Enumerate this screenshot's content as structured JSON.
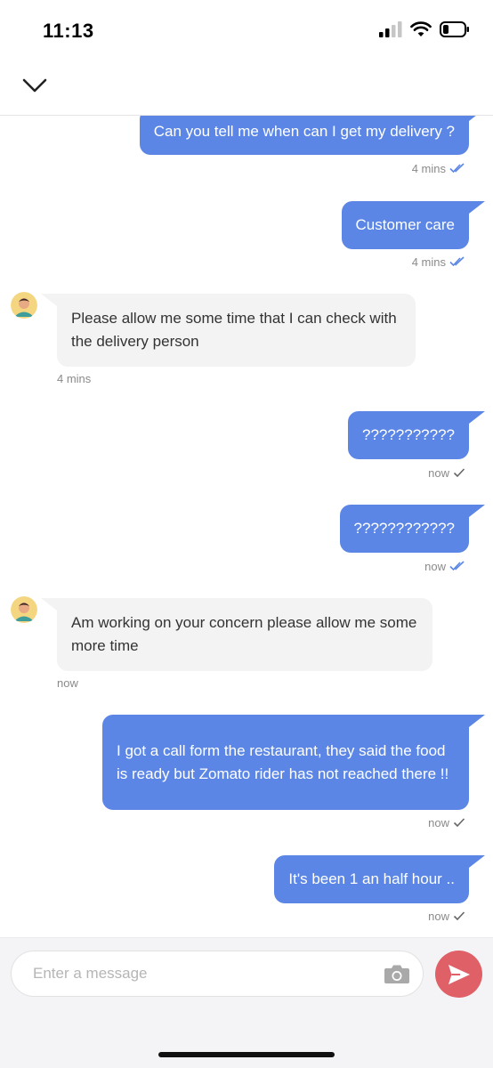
{
  "status_bar": {
    "time": "11:13"
  },
  "composer": {
    "placeholder": "Enter a message"
  },
  "messages": [
    {
      "direction": "outgoing",
      "text": "Can you tell me when can I get my delivery ?",
      "time": "4 mins",
      "receipt": "read"
    },
    {
      "direction": "outgoing",
      "text": "Customer care",
      "time": "4 mins",
      "receipt": "read"
    },
    {
      "direction": "incoming",
      "text": "Please allow me some time that I can check with the delivery person",
      "time": "4 mins"
    },
    {
      "direction": "outgoing",
      "text": "???????????",
      "time": "now",
      "receipt": "sent"
    },
    {
      "direction": "outgoing",
      "text": "????????????",
      "time": "now",
      "receipt": "read"
    },
    {
      "direction": "incoming",
      "text": "Am working on your concern please allow me some more time",
      "time": "now"
    },
    {
      "direction": "outgoing",
      "text": "I got a call form the restaurant, they said the food is ready but Zomato rider has not reached there !!",
      "time": "now",
      "receipt": "sent"
    },
    {
      "direction": "outgoing",
      "text": "It's been 1 an half hour ..",
      "time": "now",
      "receipt": "sent"
    }
  ],
  "icons": {
    "back": "chevron-down-icon",
    "camera": "camera-icon",
    "send": "send-icon",
    "read_receipt": "double-check-icon",
    "sent_receipt": "check-icon"
  },
  "colors": {
    "outgoing_bubble": "#5b86e5",
    "incoming_bubble": "#f3f3f3",
    "send_button": "#e06068",
    "read_receipt": "#5b86e5"
  }
}
